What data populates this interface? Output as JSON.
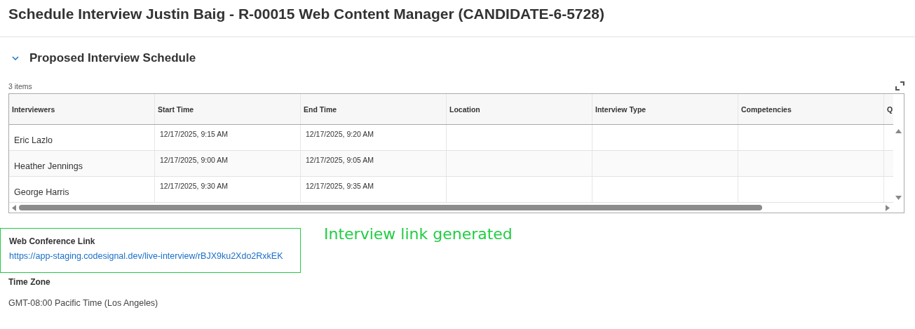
{
  "title": "Schedule Interview Justin Baig - R-00015 Web Content Manager (CANDIDATE-6-5728)",
  "section": {
    "title": "Proposed Interview Schedule",
    "expanded": true
  },
  "item_count": "3 items",
  "table": {
    "columns": [
      "Interviewers",
      "Start Time",
      "End Time",
      "Location",
      "Interview Type",
      "Competencies",
      "Q"
    ],
    "rows": [
      {
        "cells": [
          "Eric Lazlo",
          "12/17/2025, 9:15 AM",
          "12/17/2025, 9:20 AM",
          "",
          "",
          "",
          ""
        ]
      },
      {
        "cells": [
          "Heather Jennings",
          "12/17/2025, 9:00 AM",
          "12/17/2025, 9:05 AM",
          "",
          "",
          "",
          ""
        ]
      },
      {
        "cells": [
          "George Harris",
          "12/17/2025, 9:30 AM",
          "12/17/2025, 9:35 AM",
          "",
          "",
          "",
          ""
        ]
      }
    ]
  },
  "web_conference": {
    "label": "Web Conference Link",
    "link": "https://app-staging.codesignal.dev/live-interview/rBJX9ku2Xdo2RxkEK"
  },
  "annotation": "Interview link generated",
  "time_zone": {
    "label": "Time Zone",
    "value": "GMT-08:00 Pacific Time (Los Angeles)"
  }
}
